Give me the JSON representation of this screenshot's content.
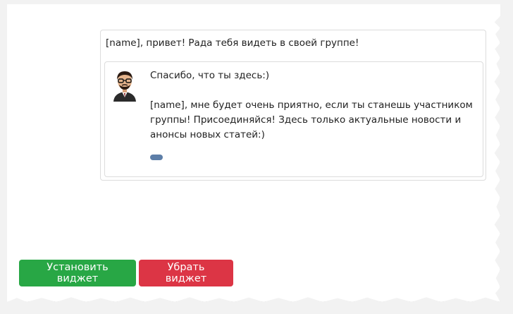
{
  "widget": {
    "greeting": "[name], привет! Рада тебя видеть в своей группе!",
    "message_line1": "Спасибо, что ты здесь:)",
    "message_line2": "[name], мне будет очень приятно, если ты станешь участником группы! Присоединяйся! Здесь только актуальные новости и анонсы новых статей:)",
    "avatar_icon": "cartoon-man-with-glasses-avatar",
    "pill_color": "#5d7ea8"
  },
  "actions": {
    "install_label": "Установить виджет",
    "remove_label": "Убрать виджет",
    "install_color": "#28a745",
    "remove_color": "#dc3545"
  }
}
